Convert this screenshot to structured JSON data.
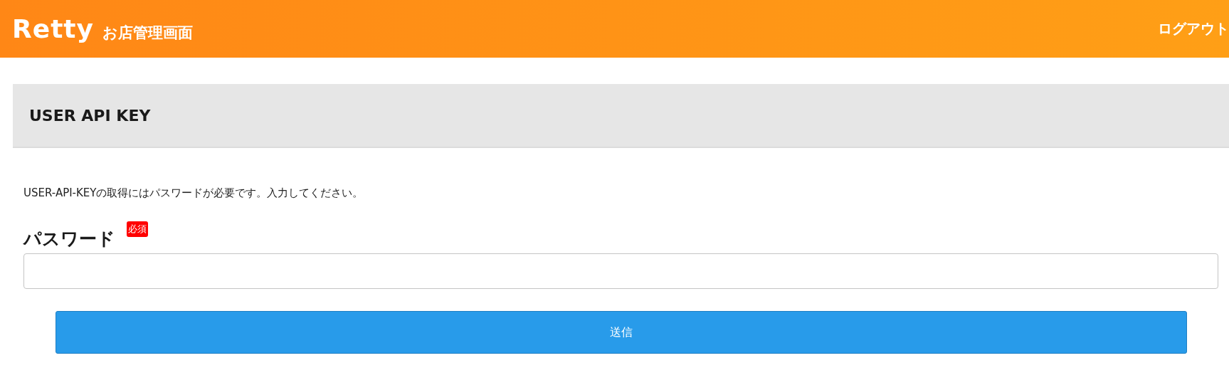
{
  "header": {
    "logo": "Retty",
    "title": "お店管理画面",
    "logout": "ログアウト"
  },
  "section": {
    "title": "USER API KEY"
  },
  "description": "USER-API-KEYの取得にはパスワードが必要です。入力してください。",
  "field": {
    "label": "パスワード",
    "required": true,
    "badge": "必須"
  },
  "submit": "送信"
}
